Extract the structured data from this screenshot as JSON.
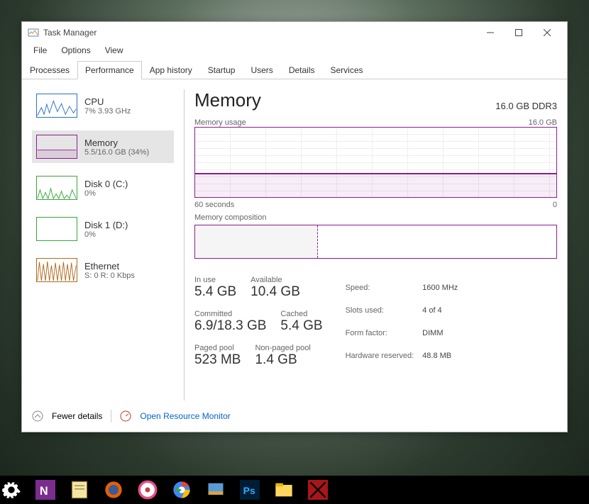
{
  "window": {
    "title": "Task Manager",
    "menus": [
      "File",
      "Options",
      "View"
    ]
  },
  "tabs": [
    "Processes",
    "Performance",
    "App history",
    "Startup",
    "Users",
    "Details",
    "Services"
  ],
  "active_tab": "Performance",
  "sidebar": [
    {
      "name": "CPU",
      "sub": "7%  3.93 GHz",
      "color": "#2a6fc9"
    },
    {
      "name": "Memory",
      "sub": "5.5/16.0 GB (34%)",
      "color": "#8b1d8e",
      "selected": true
    },
    {
      "name": "Disk 0 (C:)",
      "sub": "0%",
      "color": "#3aa43a"
    },
    {
      "name": "Disk 1 (D:)",
      "sub": "0%",
      "color": "#3aa43a"
    },
    {
      "name": "Ethernet",
      "sub": "S: 0  R: 0 Kbps",
      "color": "#b06a1f"
    }
  ],
  "main": {
    "title": "Memory",
    "spec": "16.0 GB DDR3",
    "usage_label": "Memory usage",
    "usage_max": "16.0 GB",
    "time_left": "60 seconds",
    "time_right": "0",
    "composition_label": "Memory composition",
    "stats": {
      "in_use": {
        "label": "In use",
        "value": "5.4 GB"
      },
      "available": {
        "label": "Available",
        "value": "10.4 GB"
      },
      "committed": {
        "label": "Committed",
        "value": "6.9/18.3 GB"
      },
      "cached": {
        "label": "Cached",
        "value": "5.4 GB"
      },
      "paged": {
        "label": "Paged pool",
        "value": "523 MB"
      },
      "nonpaged": {
        "label": "Non-paged pool",
        "value": "1.4 GB"
      }
    },
    "hardware": [
      [
        "Speed:",
        "1600 MHz"
      ],
      [
        "Slots used:",
        "4 of 4"
      ],
      [
        "Form factor:",
        "DIMM"
      ],
      [
        "Hardware reserved:",
        "48.8 MB"
      ]
    ]
  },
  "footer": {
    "fewer": "Fewer details",
    "resmon": "Open Resource Monitor"
  },
  "chart_data": {
    "type": "line",
    "title": "Memory usage",
    "xlabel": "60 seconds → 0",
    "ylabel": "GB",
    "ylim": [
      0,
      16
    ],
    "x": [
      60,
      55,
      50,
      45,
      40,
      35,
      30,
      25,
      20,
      15,
      10,
      5,
      0
    ],
    "values": [
      5.4,
      5.4,
      5.4,
      5.4,
      5.4,
      5.4,
      5.4,
      5.5,
      5.5,
      5.5,
      5.5,
      5.5,
      5.5
    ]
  }
}
